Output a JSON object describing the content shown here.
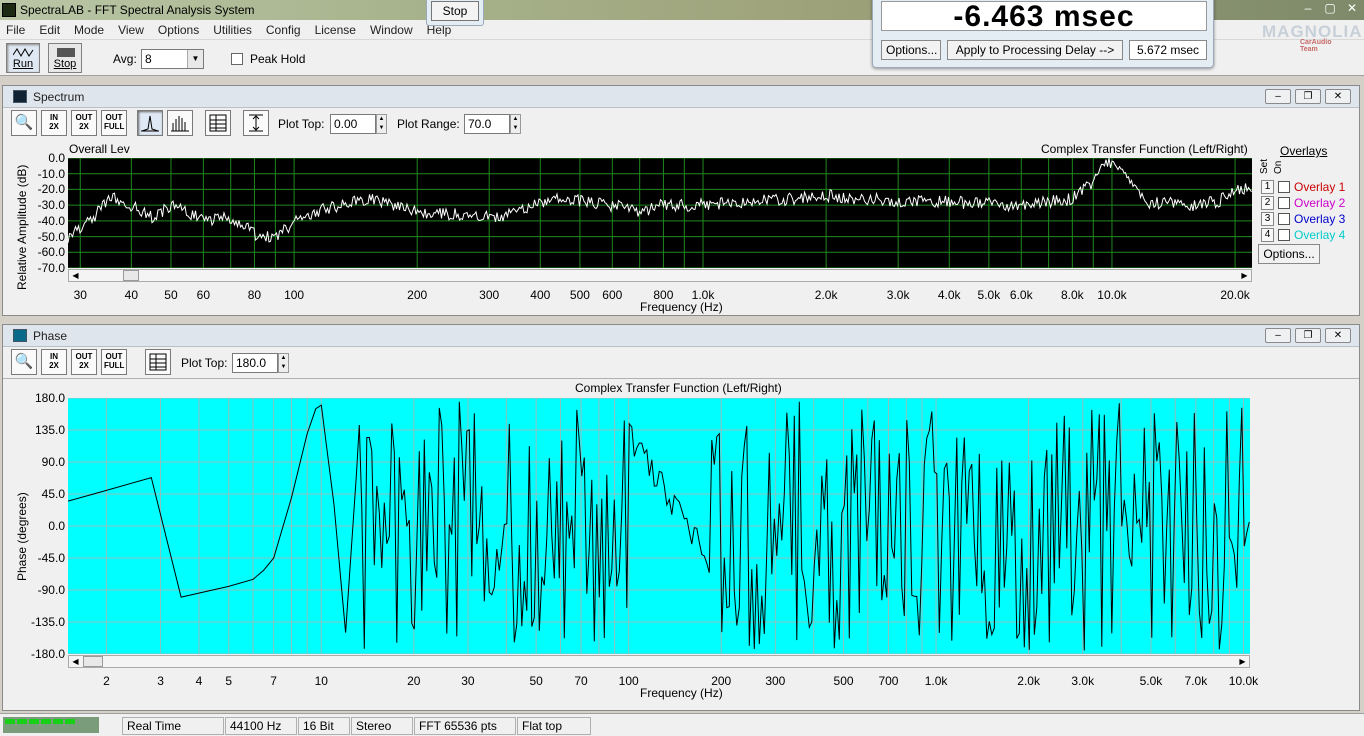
{
  "window": {
    "title": "SpectraLAB - FFT Spectral Analysis System",
    "controls": [
      "–",
      "▢",
      "✕"
    ]
  },
  "menu": [
    "File",
    "Edit",
    "Mode",
    "View",
    "Options",
    "Utilities",
    "Config",
    "License",
    "Window",
    "Help"
  ],
  "toolbar": {
    "run_label": "Run",
    "stop_label": "Stop",
    "avg_label": "Avg:",
    "avg_value": "8",
    "peak_hold_label": "Peak Hold",
    "peak_hold_checked": false
  },
  "stop_popup": {
    "label": "Stop"
  },
  "delay_window": {
    "value": "-6.463 msec",
    "options_label": "Options...",
    "apply_label": "Apply to Processing Delay -->",
    "processing_delay": "5.672 msec"
  },
  "brand": {
    "name": "MAGNOLIA",
    "sub": "CarAudio Team"
  },
  "spectrum": {
    "title": "Spectrum",
    "plot_top_label": "Plot Top:",
    "plot_top_value": "0.00",
    "plot_range_label": "Plot Range:",
    "plot_range_value": "70.0",
    "overall_level_label": "Overall Lev",
    "plot_title": "Complex Transfer Function (Left/Right)",
    "ylabel": "Relative Amplitude (dB)",
    "xlabel": "Frequency (Hz)",
    "yticks": [
      "0.0",
      "-10.0",
      "-20.0",
      "-30.0",
      "-40.0",
      "-50.0",
      "-60.0",
      "-70.0"
    ],
    "xticks": [
      "30",
      "40",
      "50",
      "60",
      "80",
      "100",
      "200",
      "300",
      "400",
      "500",
      "600",
      "800",
      "1.0k",
      "2.0k",
      "3.0k",
      "4.0k",
      "5.0k",
      "6.0k",
      "8.0k",
      "10.0k",
      "20.0k"
    ],
    "overlays_label": "Overlays",
    "set_label": "Set",
    "on_label": "On",
    "overlays": [
      {
        "num": "1",
        "label": "Overlay 1",
        "color": "#cc0000"
      },
      {
        "num": "2",
        "label": "Overlay 2",
        "color": "#cc00cc"
      },
      {
        "num": "3",
        "label": "Overlay 3",
        "color": "#0000cc"
      },
      {
        "num": "4",
        "label": "Overlay 4",
        "color": "#00cccc"
      }
    ],
    "overlay_options_label": "Options...",
    "bg_color": "#000000",
    "grid_color": "#1f8a1f",
    "trace_color": "#ffffff"
  },
  "phase": {
    "title": "Phase",
    "plot_top_label": "Plot Top:",
    "plot_top_value": "180.0",
    "plot_title": "Complex Transfer Function (Left/Right)",
    "ylabel": "Phase (degrees)",
    "xlabel": "Frequency (Hz)",
    "yticks": [
      "180.0",
      "135.0",
      "90.0",
      "45.0",
      "0.0",
      "-45.0",
      "-90.0",
      "-135.0",
      "-180.0"
    ],
    "xticks": [
      "2",
      "3",
      "4",
      "5",
      "7",
      "10",
      "20",
      "30",
      "50",
      "70",
      "100",
      "200",
      "300",
      "500",
      "700",
      "1.0k",
      "2.0k",
      "3.0k",
      "5.0k",
      "7.0k",
      "10.0k"
    ],
    "bg_color": "#00ffff",
    "grid_color": "#8fbfbf",
    "trace_color": "#000000"
  },
  "chart_data": [
    {
      "type": "line",
      "title": "Complex Transfer Function (Left/Right)",
      "xlabel": "Frequency (Hz)",
      "ylabel": "Relative Amplitude (dB)",
      "x_scale": "log",
      "xlim": [
        28,
        22000
      ],
      "ylim": [
        -70,
        0
      ],
      "grid": true,
      "series": [
        {
          "x": [
            28,
            30,
            33,
            36,
            40,
            45,
            50,
            55,
            60,
            70,
            80,
            90,
            100,
            120,
            150,
            200,
            250,
            300,
            350,
            400,
            450,
            500,
            600,
            700,
            800,
            1000,
            1200,
            1500,
            2000,
            2500,
            3000,
            4000,
            5000,
            6000,
            7000,
            8000,
            9000,
            9500,
            10000,
            11000,
            12000,
            14000,
            16000,
            18000,
            20000,
            22000
          ],
          "y": [
            -50,
            -45,
            -35,
            -25,
            -30,
            -38,
            -30,
            -35,
            -40,
            -38,
            -48,
            -52,
            -40,
            -32,
            -26,
            -34,
            -36,
            -38,
            -35,
            -28,
            -26,
            -27,
            -30,
            -34,
            -30,
            -30,
            -28,
            -27,
            -24,
            -26,
            -27,
            -28,
            -29,
            -31,
            -28,
            -26,
            -15,
            -5,
            -2,
            -12,
            -28,
            -29,
            -30,
            -28,
            -22,
            -18
          ]
        }
      ]
    },
    {
      "type": "line",
      "title": "Complex Transfer Function (Left/Right)",
      "xlabel": "Frequency (Hz)",
      "ylabel": "Phase (degrees)",
      "x_scale": "log",
      "xlim": [
        1.5,
        10500
      ],
      "ylim": [
        -180,
        180
      ],
      "grid": true,
      "series": [
        {
          "x": [
            1.5,
            2,
            2.8,
            3.5,
            5,
            6,
            6.5,
            7,
            8,
            9,
            9.6,
            10,
            11,
            12,
            13
          ],
          "y": [
            35,
            50,
            68,
            -100,
            -85,
            -75,
            -62,
            -45,
            40,
            130,
            165,
            170,
            30,
            -150,
            70
          ]
        }
      ]
    }
  ],
  "status": {
    "fields": [
      "Real Time",
      "44100 Hz",
      "16 Bit",
      "Stereo",
      "FFT 65536 pts",
      "Flat top"
    ]
  }
}
